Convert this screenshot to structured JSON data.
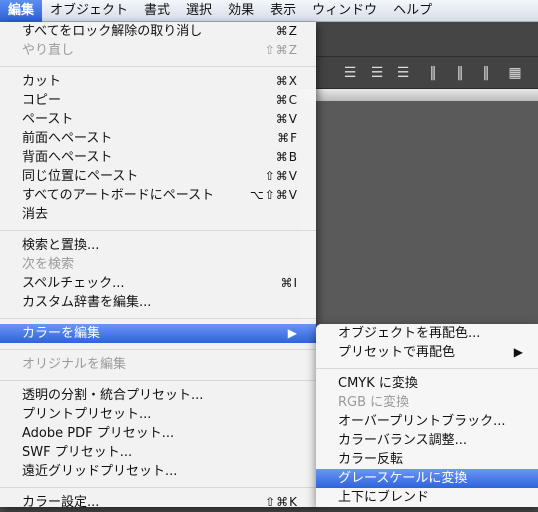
{
  "menubar": {
    "items": [
      "編集",
      "オブジェクト",
      "書式",
      "選択",
      "効果",
      "表示",
      "ウィンドウ",
      "ヘルプ"
    ],
    "active_index": 0
  },
  "edit_menu": {
    "groups": [
      [
        {
          "label": "すべてをロック解除の取り消し",
          "shortcut": "⌘Z",
          "enabled": true
        },
        {
          "label": "やり直し",
          "shortcut": "⇧⌘Z",
          "enabled": false
        }
      ],
      [
        {
          "label": "カット",
          "shortcut": "⌘X",
          "enabled": true
        },
        {
          "label": "コピー",
          "shortcut": "⌘C",
          "enabled": true
        },
        {
          "label": "ペースト",
          "shortcut": "⌘V",
          "enabled": true
        },
        {
          "label": "前面へペースト",
          "shortcut": "⌘F",
          "enabled": true
        },
        {
          "label": "背面へペースト",
          "shortcut": "⌘B",
          "enabled": true
        },
        {
          "label": "同じ位置にペースト",
          "shortcut": "⇧⌘V",
          "enabled": true
        },
        {
          "label": "すべてのアートボードにペースト",
          "shortcut": "⌥⇧⌘V",
          "enabled": true
        },
        {
          "label": "消去",
          "shortcut": "",
          "enabled": true
        }
      ],
      [
        {
          "label": "検索と置換...",
          "shortcut": "",
          "enabled": true
        },
        {
          "label": "次を検索",
          "shortcut": "",
          "enabled": false
        },
        {
          "label": "スペルチェック...",
          "shortcut": "⌘I",
          "enabled": true
        },
        {
          "label": "カスタム辞書を編集...",
          "shortcut": "",
          "enabled": true
        }
      ],
      [
        {
          "label": "カラーを編集",
          "shortcut": "▶",
          "enabled": true,
          "highlighted": true
        }
      ],
      [
        {
          "label": "オリジナルを編集",
          "shortcut": "",
          "enabled": false
        }
      ],
      [
        {
          "label": "透明の分割・統合プリセット...",
          "shortcut": "",
          "enabled": true
        },
        {
          "label": "プリントプリセット...",
          "shortcut": "",
          "enabled": true
        },
        {
          "label": "Adobe PDF プリセット...",
          "shortcut": "",
          "enabled": true
        },
        {
          "label": "SWF プリセット...",
          "shortcut": "",
          "enabled": true
        },
        {
          "label": "遠近グリッドプリセット...",
          "shortcut": "",
          "enabled": true
        }
      ],
      [
        {
          "label": "カラー設定...",
          "shortcut": "⇧⌘K",
          "enabled": true
        }
      ]
    ]
  },
  "color_submenu": {
    "groups": [
      [
        {
          "label": "オブジェクトを再配色...",
          "shortcut": "",
          "enabled": true
        },
        {
          "label": "プリセットで再配色",
          "shortcut": "▶",
          "enabled": true
        }
      ],
      [
        {
          "label": "CMYK に変換",
          "shortcut": "",
          "enabled": true
        },
        {
          "label": "RGB に変換",
          "shortcut": "",
          "enabled": false
        },
        {
          "label": "オーバープリントブラック...",
          "shortcut": "",
          "enabled": true
        },
        {
          "label": "カラーバランス調整...",
          "shortcut": "",
          "enabled": true
        },
        {
          "label": "カラー反転",
          "shortcut": "",
          "enabled": true
        },
        {
          "label": "グレースケールに変換",
          "shortcut": "",
          "enabled": true,
          "highlighted": true
        },
        {
          "label": "上下にブレンド",
          "shortcut": "",
          "enabled": true
        }
      ]
    ]
  },
  "toolbar": {
    "icons": [
      "align-vertical-top-icon",
      "align-vertical-center-icon",
      "align-vertical-bottom-icon",
      "distribute-left-icon",
      "distribute-center-icon",
      "distribute-right-icon",
      "transform-grid-icon"
    ]
  },
  "colors": {
    "highlight": "#2f62dd",
    "menu_bg": "#f6f6f6",
    "app_bg": "#4b4b4b"
  }
}
